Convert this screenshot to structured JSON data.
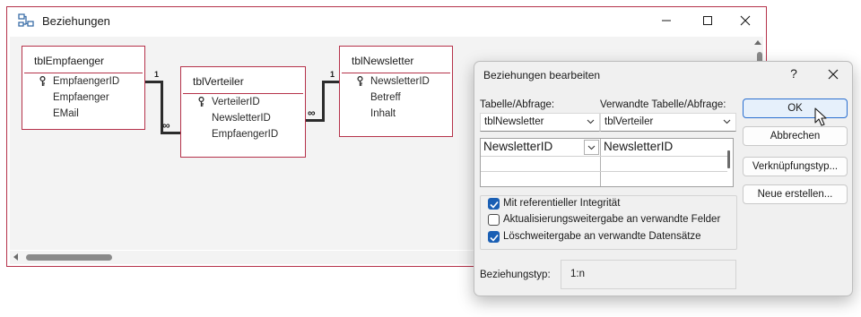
{
  "window": {
    "title": "Beziehungen"
  },
  "tables": [
    {
      "name": "tblEmpfaenger",
      "fields": [
        "EmpfaengerID",
        "Empfaenger",
        "EMail"
      ],
      "key_index": 0
    },
    {
      "name": "tblVerteiler",
      "fields": [
        "VerteilerID",
        "NewsletterID",
        "EmpfaengerID"
      ],
      "key_index": 0
    },
    {
      "name": "tblNewsletter",
      "fields": [
        "NewsletterID",
        "Betreff",
        "Inhalt"
      ],
      "key_index": 0
    }
  ],
  "relations": [
    {
      "one": "1",
      "many": "∞"
    },
    {
      "one": "1",
      "many": "∞"
    }
  ],
  "dialog": {
    "title": "Beziehungen bearbeiten",
    "help": "?",
    "table_label": "Tabelle/Abfrage:",
    "related_label": "Verwandte Tabelle/Abfrage:",
    "table_value": "tblNewsletter",
    "related_value": "tblVerteiler",
    "grid": [
      {
        "left": "NewsletterID",
        "right": "NewsletterID"
      }
    ],
    "options": [
      {
        "label": "Mit referentieller Integrität",
        "checked": true
      },
      {
        "label": "Aktualisierungsweitergabe an verwandte Felder",
        "checked": false
      },
      {
        "label": "Löschweitergabe an verwandte Datensätze",
        "checked": true
      }
    ],
    "type_label": "Beziehungstyp:",
    "type_value": "1:n",
    "buttons": {
      "ok": "OK",
      "cancel": "Abbrechen",
      "join": "Verknüpfungstyp...",
      "new": "Neue erstellen..."
    }
  },
  "colors": {
    "accent": "#b5324a",
    "check": "#1a5fb4",
    "primary_border": "#2a6fd0"
  }
}
